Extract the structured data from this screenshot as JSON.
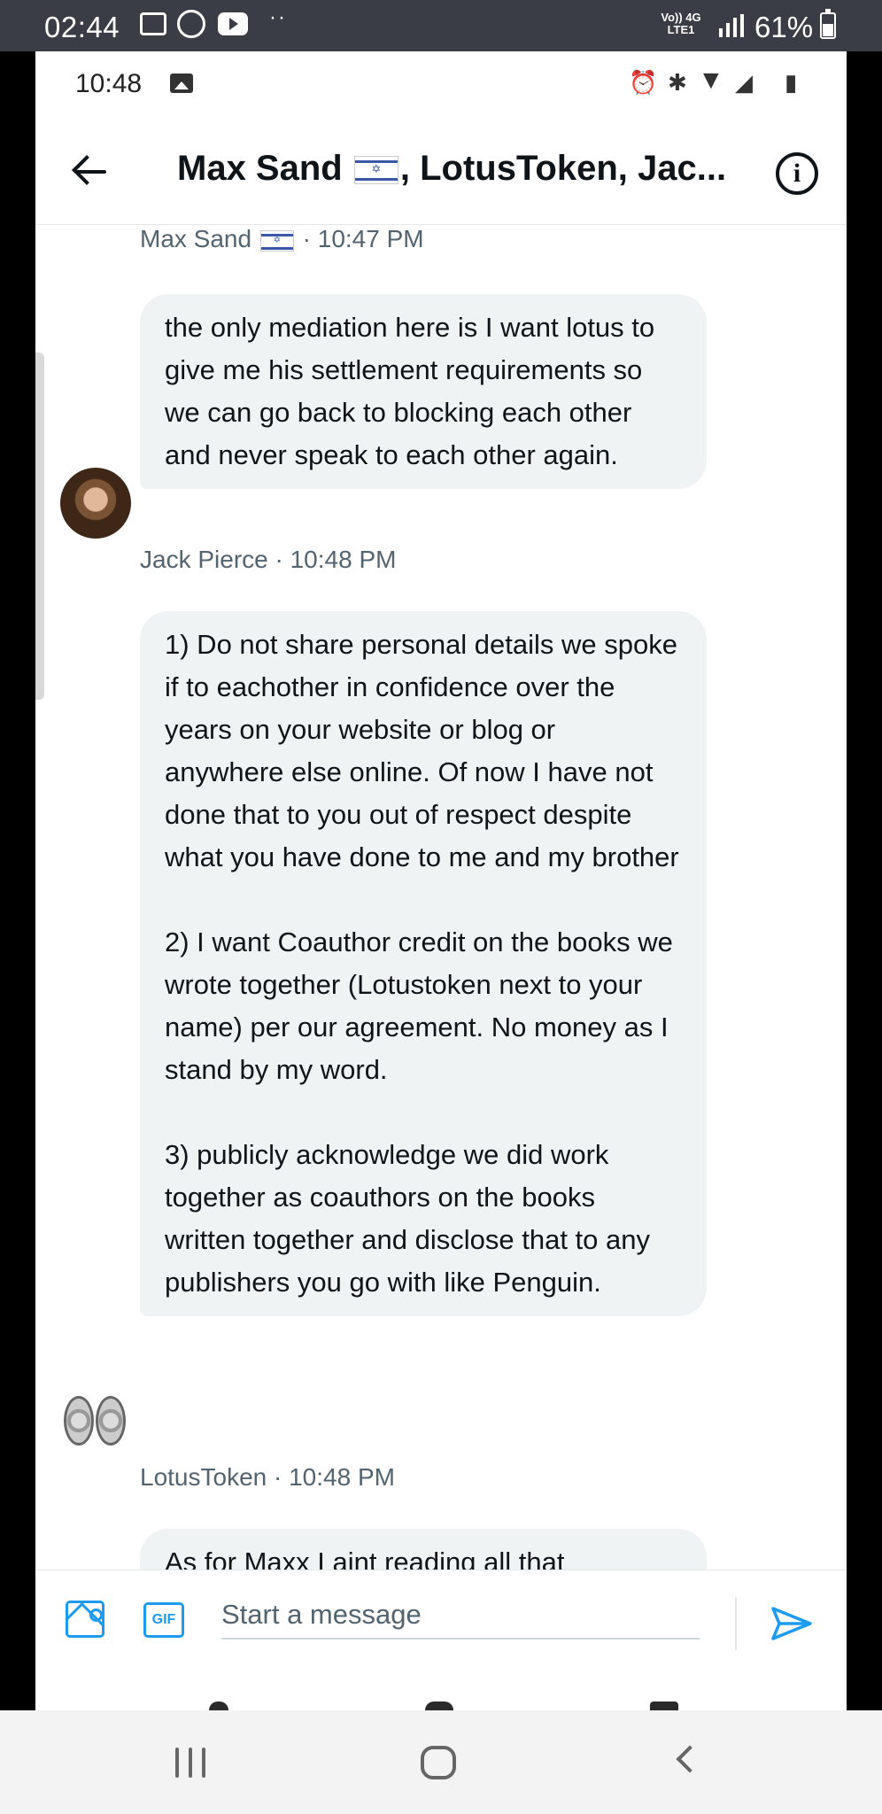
{
  "device_status": {
    "time": "02:44",
    "network": "Vo)) 4G LTE1",
    "battery": "61%"
  },
  "app_status": {
    "time": "10:48"
  },
  "header": {
    "title_name1": "Max Sand",
    "title_rest": ", LotusToken, Jac..."
  },
  "messages": [
    {
      "meta_name": "Max Sand",
      "meta_time": " · 10:47 PM"
    },
    {
      "text": "the only mediation here is I want lotus to give me his settlement requirements so we can go back to blocking each other and never speak to each other again.",
      "meta": "Jack Pierce · 10:48 PM"
    },
    {
      "text": "1) Do not share personal details we spoke if to eachother in confidence over the years on your website or blog or anywhere else online. Of now I have not done that to you out of respect despite what you have done to me and my brother\n\n2) I want Coauthor credit on the books we wrote together (Lotustoken next to your name) per our agreement. No money as I stand by my word.\n\n3) publicly acknowledge we did work together as coauthors on the books written together and disclose that to any publishers you go with like Penguin.",
      "meta": "LotusToken · 10:48 PM"
    },
    {
      "text": "As for Maxx I aint reading all that"
    }
  ],
  "composer": {
    "placeholder": "Start a message",
    "gif_label": "GIF"
  }
}
